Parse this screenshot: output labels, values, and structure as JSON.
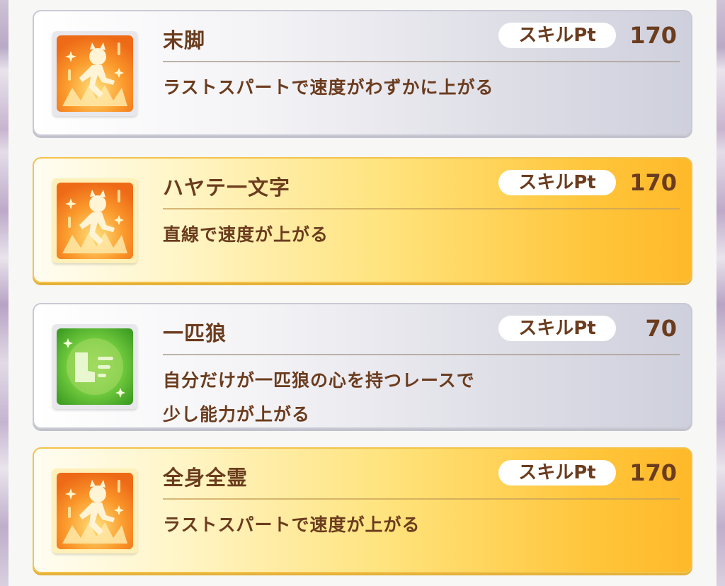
{
  "skills": [
    {
      "name": "末脚",
      "pt_label": "スキルPt",
      "pt_value": "170",
      "description": [
        "ラストスパートで速度がわずかに上がる"
      ],
      "rarity": "normal",
      "icon": "speed-runner-icon"
    },
    {
      "name": "ハヤテ一文字",
      "pt_label": "スキルPt",
      "pt_value": "170",
      "description": [
        "直線で速度が上がる"
      ],
      "rarity": "gold",
      "icon": "speed-runner-icon"
    },
    {
      "name": "一匹狼",
      "pt_label": "スキルPt",
      "pt_value": "70",
      "description": [
        "自分だけが一匹狼の心を持つレースで",
        "少し能力が上がる"
      ],
      "rarity": "normal",
      "icon": "green-boot-icon"
    },
    {
      "name": "全身全霊",
      "pt_label": "スキルPt",
      "pt_value": "170",
      "description": [
        "ラストスパートで速度が上がる"
      ],
      "rarity": "gold",
      "icon": "speed-runner-icon"
    }
  ],
  "colors": {
    "text": "#6b3c1e",
    "gold_accent": "#ffc53a",
    "normal_card": "#dcdce5",
    "speed_icon": "#f07a1a",
    "green_icon": "#4cb52d"
  }
}
